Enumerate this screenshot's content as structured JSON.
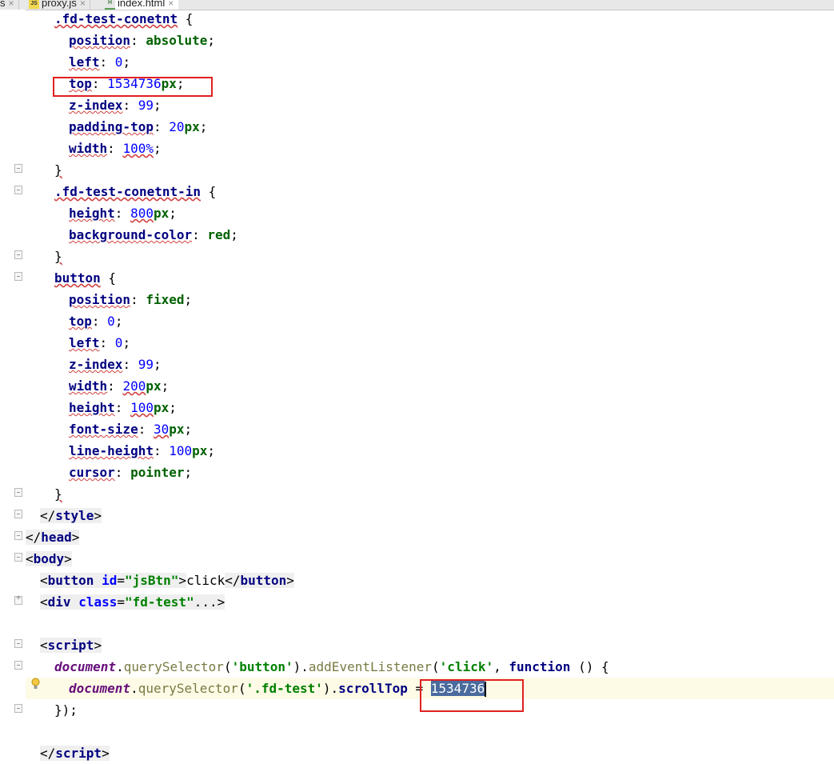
{
  "tabs": [
    {
      "label": "s",
      "icon": "none"
    },
    {
      "label": "proxy.js",
      "icon": "js-file-icon"
    },
    {
      "label": "index.html",
      "icon": "html-file-icon",
      "active": true
    }
  ],
  "tab_close": "×",
  "gutter_icons": [
    "fold-icon",
    "lightbulb-icon"
  ],
  "code": {
    "l01": {
      "sel": ".fd-test-conetnt",
      "open": " {"
    },
    "l02": {
      "prop": "position",
      "val": "absolute"
    },
    "l03": {
      "prop": "left",
      "val": "0"
    },
    "l04": {
      "prop": "top",
      "num": "1534736",
      "unit": "px"
    },
    "l05": {
      "prop": "z-index",
      "val": "99"
    },
    "l06": {
      "prop": "padding-top",
      "num": "20",
      "unit": "px"
    },
    "l07": {
      "prop": "width",
      "val": "100%"
    },
    "l08": {
      "close": "}"
    },
    "l09": {
      "sel": ".fd-test-conetnt-in",
      "open": " {"
    },
    "l10": {
      "prop": "height",
      "num": "800",
      "unit": "px"
    },
    "l11": {
      "prop": "background-color",
      "val": "red"
    },
    "l12": {
      "close": "}"
    },
    "l13": {
      "sel": "button",
      "open": " {"
    },
    "l14": {
      "prop": "position",
      "val": "fixed"
    },
    "l15": {
      "prop": "top",
      "val": "0"
    },
    "l16": {
      "prop": "left",
      "val": "0"
    },
    "l17": {
      "prop": "z-index",
      "val": "99"
    },
    "l18": {
      "prop": "width",
      "num": "200",
      "unit": "px"
    },
    "l19": {
      "prop": "height",
      "num": "100",
      "unit": "px"
    },
    "l20": {
      "prop": "font-size",
      "num": "30",
      "unit": "px"
    },
    "l21": {
      "prop": "line-height",
      "num": "100",
      "unit": "px"
    },
    "l22": {
      "prop": "cursor",
      "val": "pointer"
    },
    "l23": {
      "close": "}"
    },
    "l24": {
      "tag": "style"
    },
    "l25": {
      "tag": "head"
    },
    "l26": {
      "tag": "body"
    },
    "l27": {
      "tag": "button",
      "attr": "id",
      "aval": "\"jsBtn\"",
      "text": "click"
    },
    "l28": {
      "tag": "div",
      "attr": "class",
      "aval": "\"fd-test\"",
      "ellipsis": "..."
    },
    "l30": {
      "tag": "script"
    },
    "l31": {
      "obj": "document",
      "method": "querySelector",
      "arg": "'button'",
      "method2": "addEventListener",
      "arg2": "'click'",
      "kw": "function",
      "rest": " () {"
    },
    "l32": {
      "obj": "document",
      "method": "querySelector",
      "arg": "'.fd-test'",
      "prop": "scrollTop",
      "op": " = ",
      "val": "1534736"
    },
    "l33": {
      "text": "});"
    },
    "l35": {
      "tag": "script"
    }
  }
}
